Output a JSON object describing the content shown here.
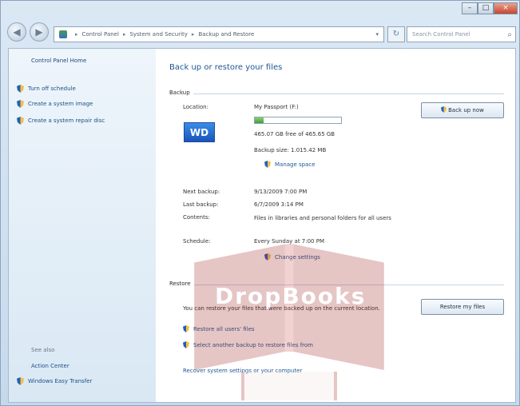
{
  "window": {
    "minimize_glyph": "–",
    "maximize_glyph": "□",
    "close_glyph": "×"
  },
  "nav": {
    "back_icon": "back-arrow-icon",
    "forward_icon": "forward-arrow-icon"
  },
  "address": {
    "separator": "▸",
    "crumbs": [
      "Control Panel",
      "System and Security",
      "Backup and Restore"
    ],
    "dropdown_glyph": "▾"
  },
  "refresh_glyph": "↻",
  "search": {
    "placeholder": "Search Control Panel",
    "icon_glyph": "⌕"
  },
  "sidebar": {
    "home": "Control Panel Home",
    "items": [
      "Turn off schedule",
      "Create a system image",
      "Create a system repair disc"
    ],
    "see_also": "See also",
    "bottom_items": [
      "Action Center",
      "Windows Easy Transfer"
    ]
  },
  "main": {
    "title": "Back up or restore your files",
    "backup_header": "Backup",
    "location_label": "Location:",
    "location_value": "My Passport (F:)",
    "free_space": "465.07 GB free of 465.65 GB",
    "backup_size": "Backup size: 1.015.42 MB",
    "manage_space": "Manage space",
    "back_up_now": "Back up now",
    "next_backup_label": "Next backup:",
    "next_backup_value": "9/13/2009 7:00 PM",
    "last_backup_label": "Last backup:",
    "last_backup_value": "6/7/2009 3:14 PM",
    "contents_label": "Contents:",
    "contents_value": "Files in libraries and personal folders for all users",
    "schedule_label": "Schedule:",
    "schedule_value": "Every Sunday at 7:00 PM",
    "change_settings": "Change settings",
    "restore_header": "Restore",
    "restore_text": "You can restore your files that were backed up on the current location.",
    "restore_all": "Restore all users' files",
    "select_another": "Select another backup to restore files from",
    "recover": "Recover system settings or your computer",
    "restore_my_files": "Restore my files",
    "logo_text": "WD",
    "backup_progress": 0.1
  },
  "watermark": {
    "text": "DropBooks"
  },
  "colors": {
    "link": "#1d5797",
    "title": "#1d5692",
    "watermark": "#9d1c1c"
  }
}
